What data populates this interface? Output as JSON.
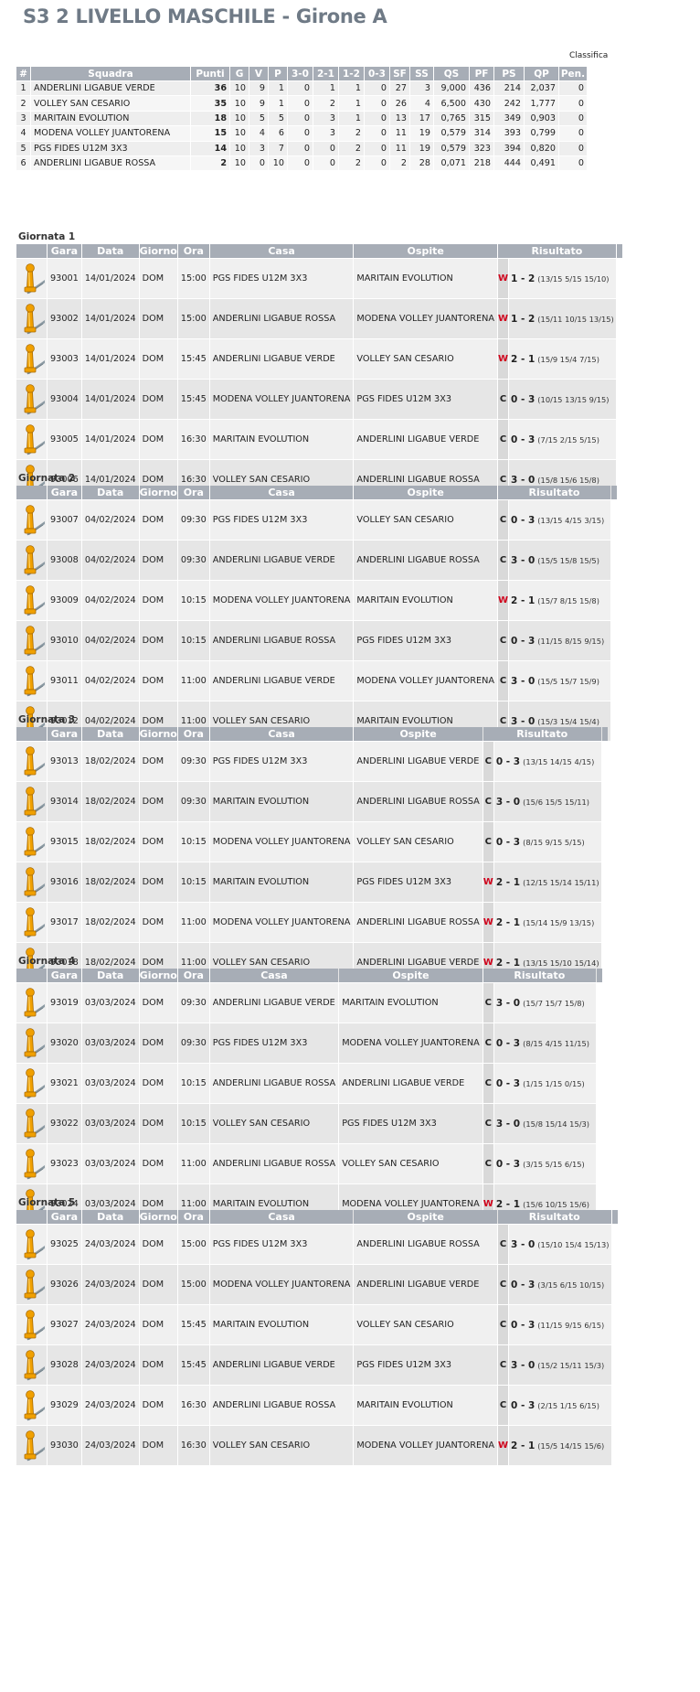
{
  "page": {
    "title": "S3 2 LIVELLO MASCHILE - Girone A"
  },
  "standings": {
    "caption": "Classifica",
    "headers": [
      "#",
      "Squadra",
      "Punti",
      "G",
      "V",
      "P",
      "3-0",
      "2-1",
      "1-2",
      "0-3",
      "SF",
      "SS",
      "QS",
      "PF",
      "PS",
      "QP",
      "Pen."
    ],
    "rows": [
      [
        "1",
        "ANDERLINI LIGABUE VERDE",
        "36",
        "10",
        "9",
        "1",
        "0",
        "1",
        "1",
        "0",
        "27",
        "3",
        "9,000",
        "436",
        "214",
        "2,037",
        "0"
      ],
      [
        "2",
        "VOLLEY SAN CESARIO",
        "35",
        "10",
        "9",
        "1",
        "0",
        "2",
        "1",
        "0",
        "26",
        "4",
        "6,500",
        "430",
        "242",
        "1,777",
        "0"
      ],
      [
        "3",
        "MARITAIN EVOLUTION",
        "18",
        "10",
        "5",
        "5",
        "0",
        "3",
        "1",
        "0",
        "13",
        "17",
        "0,765",
        "315",
        "349",
        "0,903",
        "0"
      ],
      [
        "4",
        "MODENA VOLLEY JUANTORENA",
        "15",
        "10",
        "4",
        "6",
        "0",
        "3",
        "2",
        "0",
        "11",
        "19",
        "0,579",
        "314",
        "393",
        "0,799",
        "0"
      ],
      [
        "5",
        "PGS FIDES U12M 3X3",
        "14",
        "10",
        "3",
        "7",
        "0",
        "0",
        "2",
        "0",
        "11",
        "19",
        "0,579",
        "323",
        "394",
        "0,820",
        "0"
      ],
      [
        "6",
        "ANDERLINI LIGABUE ROSSA",
        "2",
        "10",
        "0",
        "10",
        "0",
        "0",
        "2",
        "0",
        "2",
        "28",
        "0,071",
        "218",
        "444",
        "0,491",
        "0"
      ]
    ]
  },
  "fixture_headers": {
    "gara": "Gara",
    "data": "Data",
    "giorno": "Giorno",
    "ora": "Ora",
    "casa": "Casa",
    "ospite": "Ospite",
    "risultato": "Risultato"
  },
  "icons": {
    "match": "chess-pawn-icon",
    "pawn_color": "#f0a000"
  },
  "colors": {
    "header_bg": "#a7adb6",
    "win_mark": "#d0021b"
  },
  "giornate": [
    {
      "title": "Giornata 1",
      "matches": [
        {
          "gara": "93001",
          "data": "14/01/2024",
          "giorno": "DOM",
          "ora": "15:00",
          "casa": "PGS FIDES U12M 3X3",
          "ospite": "MARITAIN EVOLUTION",
          "mark": "W",
          "score": "1 - 2",
          "sets": "(13/15 5/15 15/10)"
        },
        {
          "gara": "93002",
          "data": "14/01/2024",
          "giorno": "DOM",
          "ora": "15:00",
          "casa": "ANDERLINI LIGABUE ROSSA",
          "ospite": "MODENA VOLLEY JUANTORENA",
          "mark": "W",
          "score": "1 - 2",
          "sets": "(15/11 10/15 13/15)"
        },
        {
          "gara": "93003",
          "data": "14/01/2024",
          "giorno": "DOM",
          "ora": "15:45",
          "casa": "ANDERLINI LIGABUE VERDE",
          "ospite": "VOLLEY SAN CESARIO",
          "mark": "W",
          "score": "2 - 1",
          "sets": "(15/9 15/4 7/15)"
        },
        {
          "gara": "93004",
          "data": "14/01/2024",
          "giorno": "DOM",
          "ora": "15:45",
          "casa": "MODENA VOLLEY JUANTORENA",
          "ospite": "PGS FIDES U12M 3X3",
          "mark": "C",
          "score": "0 - 3",
          "sets": "(10/15 13/15 9/15)"
        },
        {
          "gara": "93005",
          "data": "14/01/2024",
          "giorno": "DOM",
          "ora": "16:30",
          "casa": "MARITAIN EVOLUTION",
          "ospite": "ANDERLINI LIGABUE VERDE",
          "mark": "C",
          "score": "0 - 3",
          "sets": "(7/15 2/15 5/15)"
        },
        {
          "gara": "93006",
          "data": "14/01/2024",
          "giorno": "DOM",
          "ora": "16:30",
          "casa": "VOLLEY SAN CESARIO",
          "ospite": "ANDERLINI LIGABUE ROSSA",
          "mark": "C",
          "score": "3 - 0",
          "sets": "(15/8 15/6 15/8)"
        }
      ]
    },
    {
      "title": "Giornata 2",
      "matches": [
        {
          "gara": "93007",
          "data": "04/02/2024",
          "giorno": "DOM",
          "ora": "09:30",
          "casa": "PGS FIDES U12M 3X3",
          "ospite": "VOLLEY SAN CESARIO",
          "mark": "C",
          "score": "0 - 3",
          "sets": "(13/15 4/15 3/15)"
        },
        {
          "gara": "93008",
          "data": "04/02/2024",
          "giorno": "DOM",
          "ora": "09:30",
          "casa": "ANDERLINI LIGABUE VERDE",
          "ospite": "ANDERLINI LIGABUE ROSSA",
          "mark": "C",
          "score": "3 - 0",
          "sets": "(15/5 15/8 15/5)"
        },
        {
          "gara": "93009",
          "data": "04/02/2024",
          "giorno": "DOM",
          "ora": "10:15",
          "casa": "MODENA VOLLEY JUANTORENA",
          "ospite": "MARITAIN EVOLUTION",
          "mark": "W",
          "score": "2 - 1",
          "sets": "(15/7 8/15 15/8)"
        },
        {
          "gara": "93010",
          "data": "04/02/2024",
          "giorno": "DOM",
          "ora": "10:15",
          "casa": "ANDERLINI LIGABUE ROSSA",
          "ospite": "PGS FIDES U12M 3X3",
          "mark": "C",
          "score": "0 - 3",
          "sets": "(11/15 8/15 9/15)"
        },
        {
          "gara": "93011",
          "data": "04/02/2024",
          "giorno": "DOM",
          "ora": "11:00",
          "casa": "ANDERLINI LIGABUE VERDE",
          "ospite": "MODENA VOLLEY JUANTORENA",
          "mark": "C",
          "score": "3 - 0",
          "sets": "(15/5 15/7 15/9)"
        },
        {
          "gara": "93012",
          "data": "04/02/2024",
          "giorno": "DOM",
          "ora": "11:00",
          "casa": "VOLLEY SAN CESARIO",
          "ospite": "MARITAIN EVOLUTION",
          "mark": "C",
          "score": "3 - 0",
          "sets": "(15/3 15/4 15/4)"
        }
      ]
    },
    {
      "title": "Giornata 3",
      "matches": [
        {
          "gara": "93013",
          "data": "18/02/2024",
          "giorno": "DOM",
          "ora": "09:30",
          "casa": "PGS FIDES U12M 3X3",
          "ospite": "ANDERLINI LIGABUE VERDE",
          "mark": "C",
          "score": "0 - 3",
          "sets": "(13/15 14/15 4/15)"
        },
        {
          "gara": "93014",
          "data": "18/02/2024",
          "giorno": "DOM",
          "ora": "09:30",
          "casa": "MARITAIN EVOLUTION",
          "ospite": "ANDERLINI LIGABUE ROSSA",
          "mark": "C",
          "score": "3 - 0",
          "sets": "(15/6 15/5 15/11)"
        },
        {
          "gara": "93015",
          "data": "18/02/2024",
          "giorno": "DOM",
          "ora": "10:15",
          "casa": "MODENA VOLLEY JUANTORENA",
          "ospite": "VOLLEY SAN CESARIO",
          "mark": "C",
          "score": "0 - 3",
          "sets": "(8/15 9/15 5/15)"
        },
        {
          "gara": "93016",
          "data": "18/02/2024",
          "giorno": "DOM",
          "ora": "10:15",
          "casa": "MARITAIN EVOLUTION",
          "ospite": "PGS FIDES U12M 3X3",
          "mark": "W",
          "score": "2 - 1",
          "sets": "(12/15 15/14 15/11)"
        },
        {
          "gara": "93017",
          "data": "18/02/2024",
          "giorno": "DOM",
          "ora": "11:00",
          "casa": "MODENA VOLLEY JUANTORENA",
          "ospite": "ANDERLINI LIGABUE ROSSA",
          "mark": "W",
          "score": "2 - 1",
          "sets": "(15/14 15/9 13/15)"
        },
        {
          "gara": "93018",
          "data": "18/02/2024",
          "giorno": "DOM",
          "ora": "11:00",
          "casa": "VOLLEY SAN CESARIO",
          "ospite": "ANDERLINI LIGABUE VERDE",
          "mark": "W",
          "score": "2 - 1",
          "sets": "(13/15 15/10 15/14)"
        }
      ]
    },
    {
      "title": "Giornata 4",
      "matches": [
        {
          "gara": "93019",
          "data": "03/03/2024",
          "giorno": "DOM",
          "ora": "09:30",
          "casa": "ANDERLINI LIGABUE VERDE",
          "ospite": "MARITAIN EVOLUTION",
          "mark": "C",
          "score": "3 - 0",
          "sets": "(15/7 15/7 15/8)"
        },
        {
          "gara": "93020",
          "data": "03/03/2024",
          "giorno": "DOM",
          "ora": "09:30",
          "casa": "PGS FIDES U12M 3X3",
          "ospite": "MODENA VOLLEY JUANTORENA",
          "mark": "C",
          "score": "0 - 3",
          "sets": "(8/15 4/15 11/15)"
        },
        {
          "gara": "93021",
          "data": "03/03/2024",
          "giorno": "DOM",
          "ora": "10:15",
          "casa": "ANDERLINI LIGABUE ROSSA",
          "ospite": "ANDERLINI LIGABUE VERDE",
          "mark": "C",
          "score": "0 - 3",
          "sets": "(1/15 1/15 0/15)"
        },
        {
          "gara": "93022",
          "data": "03/03/2024",
          "giorno": "DOM",
          "ora": "10:15",
          "casa": "VOLLEY SAN CESARIO",
          "ospite": "PGS FIDES U12M 3X3",
          "mark": "C",
          "score": "3 - 0",
          "sets": "(15/8 15/14 15/3)"
        },
        {
          "gara": "93023",
          "data": "03/03/2024",
          "giorno": "DOM",
          "ora": "11:00",
          "casa": "ANDERLINI LIGABUE ROSSA",
          "ospite": "VOLLEY SAN CESARIO",
          "mark": "C",
          "score": "0 - 3",
          "sets": "(3/15 5/15 6/15)"
        },
        {
          "gara": "93024",
          "data": "03/03/2024",
          "giorno": "DOM",
          "ora": "11:00",
          "casa": "MARITAIN EVOLUTION",
          "ospite": "MODENA VOLLEY JUANTORENA",
          "mark": "W",
          "score": "2 - 1",
          "sets": "(15/6 10/15 15/6)"
        }
      ]
    },
    {
      "title": "Giornata 5",
      "matches": [
        {
          "gara": "93025",
          "data": "24/03/2024",
          "giorno": "DOM",
          "ora": "15:00",
          "casa": "PGS FIDES U12M 3X3",
          "ospite": "ANDERLINI LIGABUE ROSSA",
          "mark": "C",
          "score": "3 - 0",
          "sets": "(15/10 15/4 15/13)"
        },
        {
          "gara": "93026",
          "data": "24/03/2024",
          "giorno": "DOM",
          "ora": "15:00",
          "casa": "MODENA VOLLEY JUANTORENA",
          "ospite": "ANDERLINI LIGABUE VERDE",
          "mark": "C",
          "score": "0 - 3",
          "sets": "(3/15 6/15 10/15)"
        },
        {
          "gara": "93027",
          "data": "24/03/2024",
          "giorno": "DOM",
          "ora": "15:45",
          "casa": "MARITAIN EVOLUTION",
          "ospite": "VOLLEY SAN CESARIO",
          "mark": "C",
          "score": "0 - 3",
          "sets": "(11/15 9/15 6/15)"
        },
        {
          "gara": "93028",
          "data": "24/03/2024",
          "giorno": "DOM",
          "ora": "15:45",
          "casa": "ANDERLINI LIGABUE VERDE",
          "ospite": "PGS FIDES U12M 3X3",
          "mark": "C",
          "score": "3 - 0",
          "sets": "(15/2 15/11 15/3)"
        },
        {
          "gara": "93029",
          "data": "24/03/2024",
          "giorno": "DOM",
          "ora": "16:30",
          "casa": "ANDERLINI LIGABUE ROSSA",
          "ospite": "MARITAIN EVOLUTION",
          "mark": "C",
          "score": "0 - 3",
          "sets": "(2/15 1/15 6/15)"
        },
        {
          "gara": "93030",
          "data": "24/03/2024",
          "giorno": "DOM",
          "ora": "16:30",
          "casa": "VOLLEY SAN CESARIO",
          "ospite": "MODENA VOLLEY JUANTORENA",
          "mark": "W",
          "score": "2 - 1",
          "sets": "(15/5 14/15 15/6)"
        }
      ]
    }
  ]
}
